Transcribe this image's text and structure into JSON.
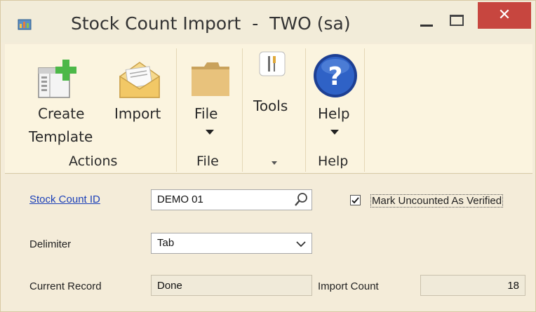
{
  "window": {
    "title": "Stock Count Import  -  TWO (sa)",
    "close_glyph": "✕"
  },
  "ribbon": {
    "create_template_line1": "Create",
    "create_template_line2": "Template",
    "import_label": "Import",
    "actions_group": "Actions",
    "file_label": "File",
    "file_group": "File",
    "tools_label": "Tools",
    "help_label": "Help",
    "help_group": "Help"
  },
  "form": {
    "stock_count_id_label": "Stock Count ID",
    "stock_count_id_value": "DEMO 01",
    "mark_uncounted_label": "Mark Uncounted As Verified",
    "mark_uncounted_checked": true,
    "delimiter_label": "Delimiter",
    "delimiter_value": "Tab",
    "current_record_label": "Current Record",
    "current_record_value": "Done",
    "import_count_label": "Import Count",
    "import_count_value": "18"
  },
  "colors": {
    "close_button": "#c7463f",
    "link": "#1a3fb8",
    "background": "#f4ecd9"
  }
}
